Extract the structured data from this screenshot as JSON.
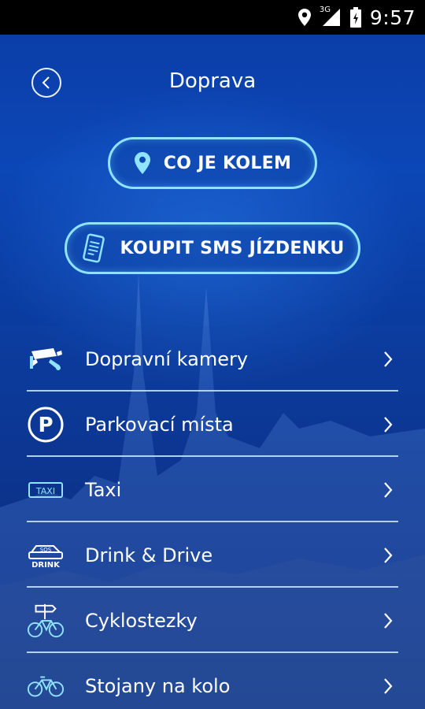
{
  "status_bar": {
    "time": "9:57",
    "network_label": "3G",
    "icons": [
      "location-icon",
      "signal-icon",
      "battery-icon"
    ]
  },
  "header": {
    "title": "Doprava",
    "back_icon": "chevron-left-icon"
  },
  "actions": [
    {
      "label": "CO JE KOLEM",
      "icon": "map-pin-icon"
    },
    {
      "label": "KOUPIT SMS JÍZDENKU",
      "icon": "sms-ticket-icon"
    }
  ],
  "menu": [
    {
      "label": "Dopravní kamery",
      "icon": "camera-icon"
    },
    {
      "label": "Parkovací místa",
      "icon": "parking-icon"
    },
    {
      "label": "Taxi",
      "icon": "taxi-icon"
    },
    {
      "label": "Drink & Drive",
      "icon": "sos-drink-icon"
    },
    {
      "label": "Cyklostezky",
      "icon": "bike-path-icon"
    },
    {
      "label": "Stojany na kolo",
      "icon": "bicycle-icon"
    }
  ],
  "icon_text": {
    "taxi": "TAXI",
    "sos": "SOS",
    "drink": "DRINK",
    "parking": "P"
  },
  "colors": {
    "accent": "#8fe3ff",
    "background": "#0c47b7",
    "text": "#ffffff"
  }
}
